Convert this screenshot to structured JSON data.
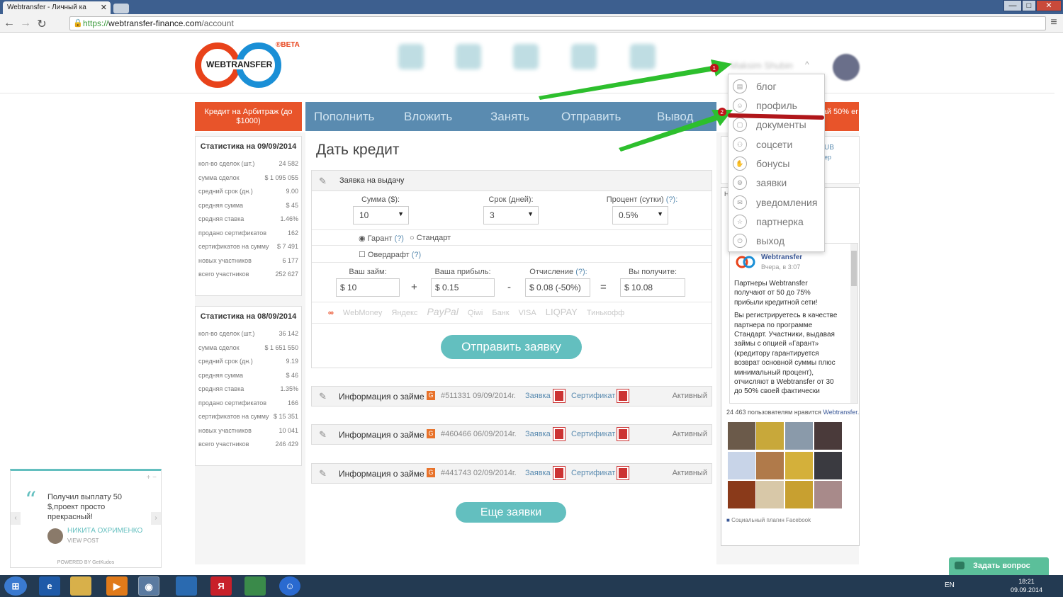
{
  "browser": {
    "tab_title": "Webtransfer - Личный ка",
    "tab_close": "✕",
    "url_scheme": "https://",
    "url_host": "webtransfer-finance.com",
    "url_path": "/account",
    "win_min": "—",
    "win_max": "□",
    "win_close": "✕",
    "back": "←",
    "forward": "→",
    "reload": "↻",
    "menu": "≡"
  },
  "header": {
    "logo_text": "WEBTRANSFER",
    "beta_label": "®BETA",
    "username": "Maksim Shubin",
    "caret": "^"
  },
  "nav": {
    "promo_left": "Кредит на Арбитраж (до $1000)",
    "items": [
      "Пополнить",
      "Вложить",
      "Занять",
      "Отправить",
      "Вывод"
    ],
    "promo_right": "ай 50% ег"
  },
  "stats": [
    {
      "title": "Статистика на 09/09/2014",
      "rows": [
        {
          "label": "кол-во сделок (шт.)",
          "value": "24 582"
        },
        {
          "label": "сумма сделок",
          "value": "$ 1 095 055"
        },
        {
          "label": "средний срок (дн.)",
          "value": "9.00"
        },
        {
          "label": "средняя сумма",
          "value": "$ 45"
        },
        {
          "label": "средняя ставка",
          "value": "1.46%"
        },
        {
          "label": "продано сертификатов",
          "value": "162"
        },
        {
          "label": "сертификатов на сумму",
          "value": "$ 7 491"
        },
        {
          "label": "новых участников",
          "value": "6 177"
        },
        {
          "label": "всего участников",
          "value": "252 627"
        }
      ]
    },
    {
      "title": "Статистика на 08/09/2014",
      "rows": [
        {
          "label": "кол-во сделок (шт.)",
          "value": "36 142"
        },
        {
          "label": "сумма сделок",
          "value": "$ 1 651 550"
        },
        {
          "label": "средний срок (дн.)",
          "value": "9.19"
        },
        {
          "label": "средняя сумма",
          "value": "$ 46"
        },
        {
          "label": "средняя ставка",
          "value": "1.35%"
        },
        {
          "label": "продано сертификатов",
          "value": "166"
        },
        {
          "label": "сертификатов на сумму",
          "value": "$ 15 351"
        },
        {
          "label": "новых участников",
          "value": "10 041"
        },
        {
          "label": "всего участников",
          "value": "246 429"
        }
      ]
    }
  ],
  "form": {
    "title": "Дать кредит",
    "header": "Заявка на выдачу",
    "amount_label": "Сумма ($):",
    "amount_value": "10",
    "term_label": "Срок (дней):",
    "term_value": "3",
    "rate_label": "Процент (сутки)",
    "rate_q": "(?):",
    "rate_value": "0.5%",
    "guarantee": "Гарант",
    "guarantee_q": "(?)",
    "standard": "Стандарт",
    "overdraft": "Овердрафт",
    "overdraft_q": "(?)",
    "loan_label": "Ваш займ:",
    "loan_value": "$ 10",
    "profit_label": "Ваша прибыль:",
    "profit_value": "$ 0.15",
    "fee_label": "Отчисление",
    "fee_q": "(?):",
    "fee_value": "$ 0.08 (-50%)",
    "receive_label": "Вы получите:",
    "receive_value": "$ 10.08",
    "op_plus": "+",
    "op_minus": "-",
    "op_eq": "=",
    "payment_logos": [
      "WebMoney",
      "Яндекс",
      "PayPal",
      "Qiwi",
      "Банк",
      "VISA",
      "LIQPAY",
      "Тинькофф"
    ],
    "submit": "Отправить заявку",
    "more": "Еще заявки"
  },
  "loans": [
    {
      "title": "Информация о займе",
      "badge": "G",
      "number": "#511331 09/09/2014г.",
      "request": "Заявка",
      "certificate": "Сертификат",
      "status": "Активный"
    },
    {
      "title": "Информация о займе",
      "badge": "G",
      "number": "#460466 06/09/2014г.",
      "request": "Заявка",
      "certificate": "Сертификат",
      "status": "Активный"
    },
    {
      "title": "Информация о займе",
      "badge": "G",
      "number": "#441743 02/09/2014г.",
      "request": "Заявка",
      "certificate": "Сертификат",
      "status": "Активный"
    }
  ],
  "dropdown": {
    "items": [
      "блог",
      "профиль",
      "документы",
      "соцсети",
      "бонусы",
      "заявки",
      "уведомления",
      "партнерка",
      "выход"
    ]
  },
  "annotations": {
    "marker1": "1",
    "marker2": "2"
  },
  "facebook": {
    "page_name": "Webtransfer",
    "post_date": "Вчера, в 3:07",
    "post_p1": "Партнеры Webtransfer получают от 50 до 75% прибыли кредитной сети!",
    "post_p2": "Вы регистрируетесь в качестве партнера по программе Стандарт. Участники, выдавая займы с опцией «Гарант» (кредитору гарантируется возврат основной суммы плюс минимальный процент), отчисляют в Webtransfer от 30 до 50% своей фактически",
    "likes_prefix": "24 463 пользователям нравится",
    "likes_page": "Webtransfer.",
    "footer": "Социальный плагин Facebook",
    "side_text_1": "UB",
    "side_text_2": "ep",
    "side_text_3": "H"
  },
  "kudos": {
    "quote_mark": "“",
    "text": "Получил выплату 50 $,проект просто прекрасный!",
    "author": "НИКИТА ОХРИМЕНКО",
    "view": "VIEW POST",
    "powered": "POWERED BY GetKudos",
    "controls": "+ −",
    "prev": "‹",
    "next": "›"
  },
  "ask": {
    "label": "Задать вопрос"
  },
  "taskbar": {
    "lang": "EN",
    "time": "18:21",
    "date": "09.09.2014",
    "start": "⊞",
    "yandex": "Я"
  }
}
